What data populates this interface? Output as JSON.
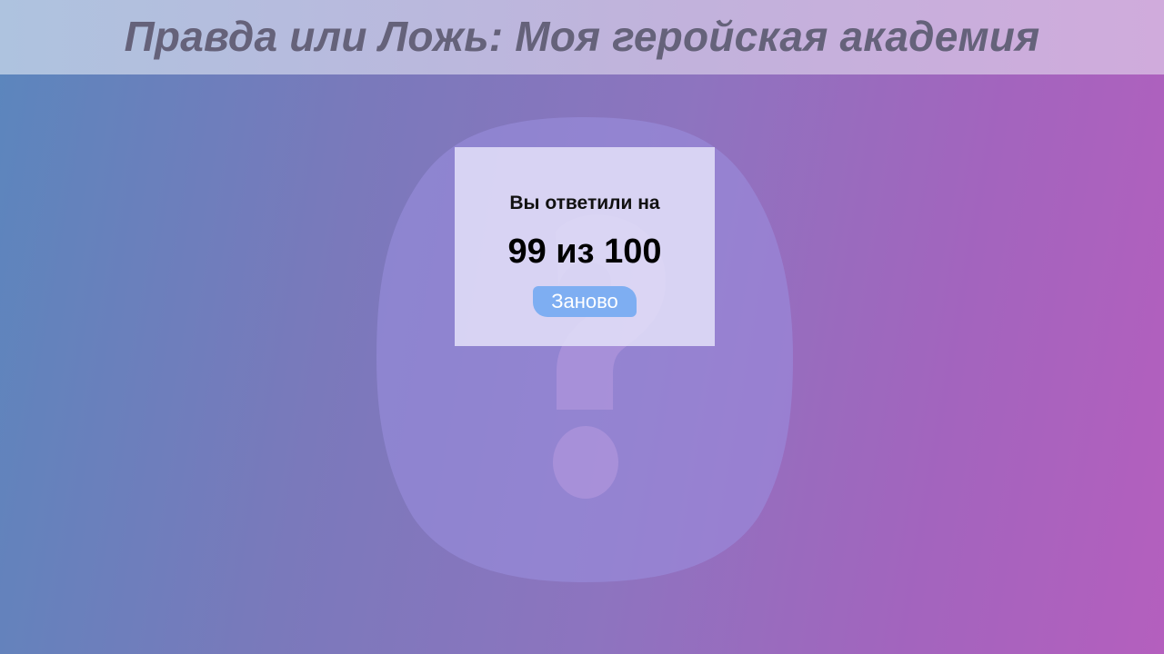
{
  "header": {
    "title": "Правда или Ложь: Моя геройская академия"
  },
  "background": {
    "icon": "question-mark-icon"
  },
  "result": {
    "answered_label": "Вы ответили на",
    "score_text": "99 из 100",
    "restart_label": "Заново"
  },
  "colors": {
    "button": "#7eaef2",
    "title": "#65627a"
  }
}
